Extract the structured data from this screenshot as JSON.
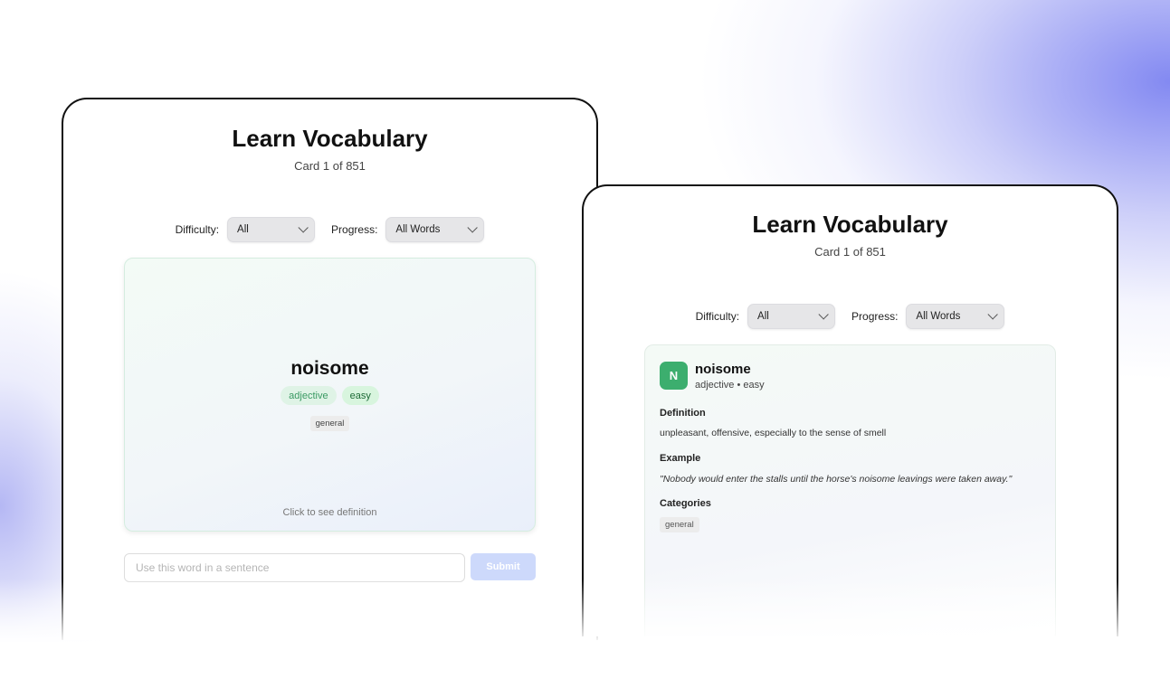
{
  "app": {
    "title": "Learn Vocabulary",
    "card_counter": "Card 1 of 851"
  },
  "filters": {
    "difficulty_label": "Difficulty:",
    "difficulty_value": "All",
    "progress_label": "Progress:",
    "progress_value": "All Words"
  },
  "word": {
    "text": "noisome",
    "initial": "N",
    "part_of_speech": "adjective",
    "difficulty": "easy",
    "meta": "adjective • easy",
    "category": "general",
    "definition": "unpleasant, offensive, especially to the sense of smell",
    "example": "\"Nobody would enter the stalls until the horse's noisome leavings were taken away.\""
  },
  "card_front": {
    "hint": "Click to see definition"
  },
  "detail": {
    "definition_label": "Definition",
    "example_label": "Example",
    "categories_label": "Categories"
  },
  "sentence": {
    "placeholder": "Use this word in a sentence",
    "submit_label": "Submit"
  },
  "colors": {
    "accent_green": "#3cae6e",
    "submit_disabled": "#cdd9fb",
    "background_glow": "#6068ee"
  }
}
